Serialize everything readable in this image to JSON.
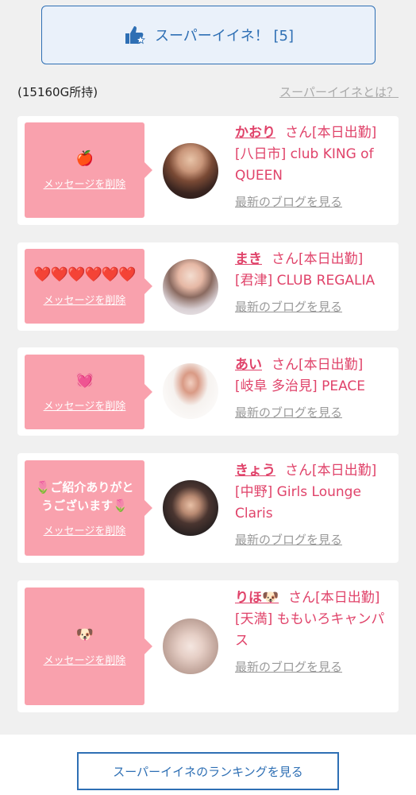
{
  "super_iine": {
    "label": "スーパーイイネ！ [5]",
    "icon": "thumbs-up-star-icon",
    "color": "#2e6fb4"
  },
  "points_text": "(15160G所持)",
  "whatis_link": "スーパーイイネとは？",
  "cards": [
    {
      "message": "🍎",
      "delete_label": "メッセージを削除",
      "name": "かおり",
      "san": "さん[本日出勤]",
      "shop": "[八日市] club KING of QUEEN",
      "blog_link": "最新のブログを見る"
    },
    {
      "message": "❤️❤️❤️❤️❤️❤️",
      "delete_label": "メッセージを削除",
      "name": "まき",
      "san": "さん[本日出勤]",
      "shop": "[君津] CLUB REGALIA",
      "blog_link": "最新のブログを見る"
    },
    {
      "message": "💓",
      "delete_label": "メッセージを削除",
      "name": "あい",
      "san": "さん[本日出勤]",
      "shop": "[岐阜 多治見] PEACE",
      "blog_link": "最新のブログを見る"
    },
    {
      "message": "🌷ご紹介ありがとうございます🌷",
      "delete_label": "メッセージを削除",
      "name": "きょう",
      "san": "さん[本日出勤]",
      "shop": "[中野] Girls Lounge Claris",
      "blog_link": "最新のブログを見る"
    },
    {
      "message": "🐶",
      "delete_label": "メッセージを削除",
      "name": "りほ🐶",
      "san": "さん[本日出勤]",
      "shop": "[天満] ももいろキャンパス",
      "blog_link": "最新のブログを見る"
    }
  ],
  "ranking_button": "スーパーイイネのランキングを見る",
  "colors": {
    "accent_blue": "#2e6fb4",
    "message_pink": "#f9a1ad",
    "name_pink": "#e0436a"
  }
}
